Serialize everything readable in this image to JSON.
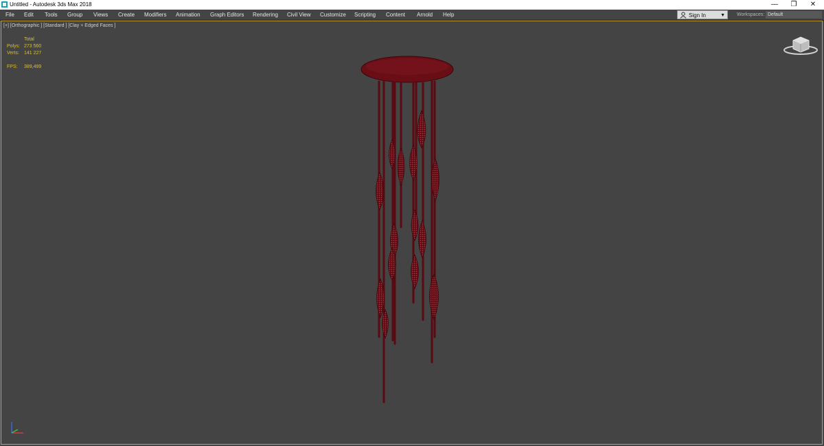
{
  "window": {
    "title": "Untitled - Autodesk 3ds Max 2018",
    "controls": {
      "minimize": "—",
      "restore": "❐",
      "close": "✕"
    }
  },
  "menu": {
    "items": [
      "File",
      "Edit",
      "Tools",
      "Group",
      "Views",
      "Create",
      "Modifiers",
      "Animation",
      "Graph Editors",
      "Rendering",
      "Civil View",
      "Customize",
      "Scripting",
      "Content",
      "Arnold",
      "Help"
    ],
    "sign_in": "Sign In",
    "workspaces_label": "Workspaces:",
    "workspace_value": "Default"
  },
  "viewport": {
    "label": "[+] [Orthographic ] [Standard ] [Clay + Edged Faces ]",
    "stats": {
      "header": "Total",
      "polys_label": "Polys:",
      "polys_value": "273 560",
      "verts_label": "Verts:",
      "verts_value": "141 227",
      "fps_label": "FPS:",
      "fps_value": "389,499"
    }
  },
  "colors": {
    "model": "#6e0f17",
    "model_highlight": "#a8323c",
    "stats_text": "#d9c12a",
    "viewport_border": "#c8a23c",
    "background": "#444444"
  },
  "icons": {
    "app": "3ds-max-icon",
    "user": "user-icon",
    "viewcube": "viewcube-icon",
    "axis": "axis-tripod-icon"
  }
}
